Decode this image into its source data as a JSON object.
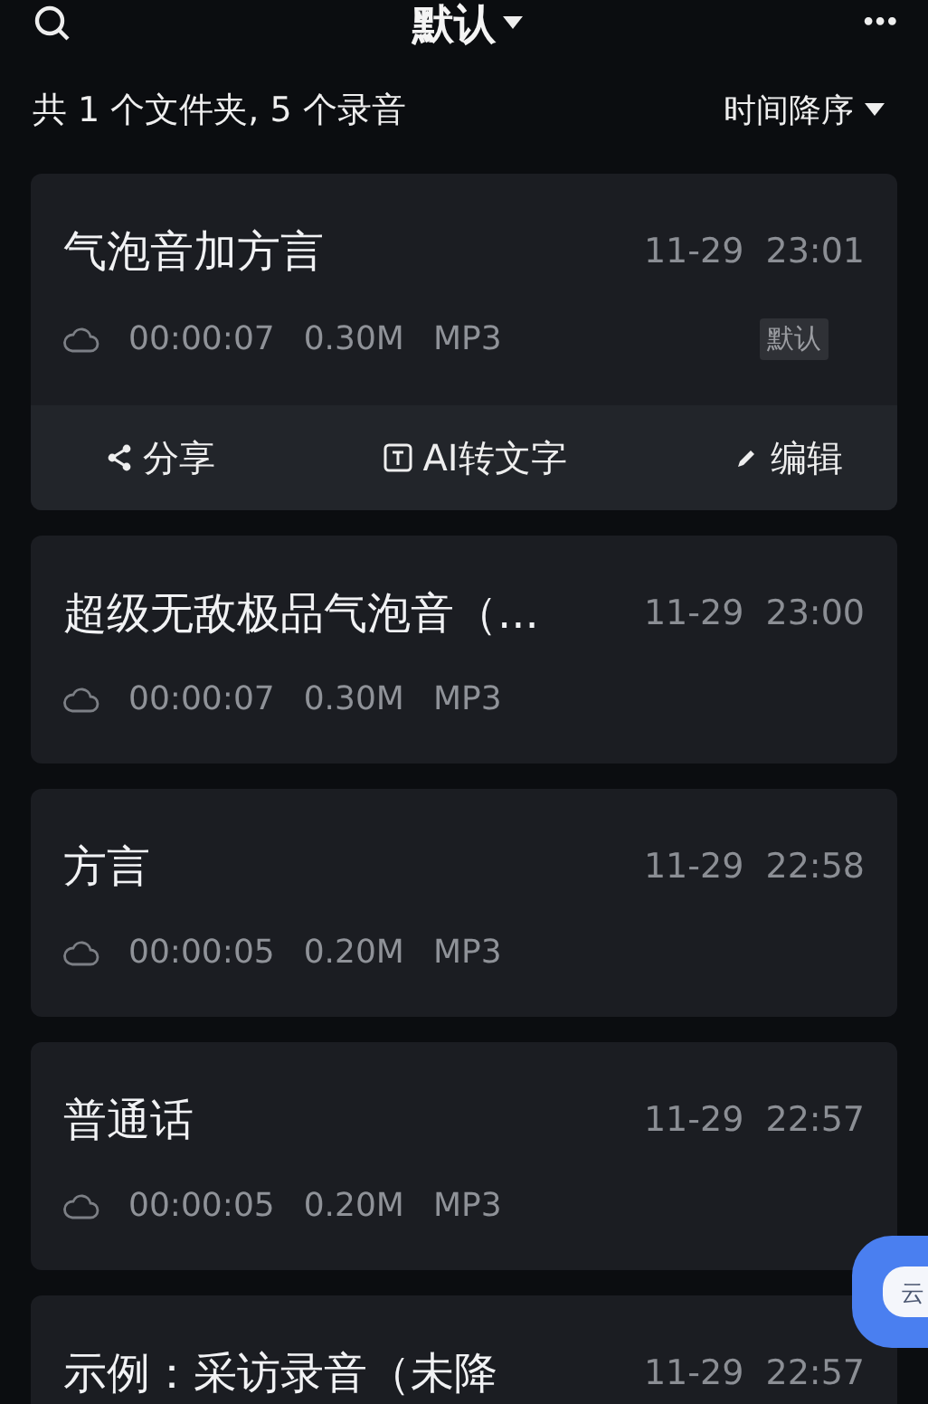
{
  "header": {
    "title": "默认",
    "more": "•••"
  },
  "summary": {
    "text": "共 1 个文件夹, 5 个录音",
    "sort": "时间降序"
  },
  "recordings": [
    {
      "title": "气泡音加方言",
      "date": "11-29",
      "time": "23:01",
      "duration": "00:00:07",
      "size": "0.30M",
      "format": "MP3",
      "tag": "默认",
      "actions": [
        {
          "kind": "share",
          "label": "分享"
        },
        {
          "kind": "transcribe",
          "label": "AI转文字"
        },
        {
          "kind": "edit",
          "label": "编辑"
        }
      ]
    },
    {
      "title": "超级无敌极品气泡音（...",
      "date": "11-29",
      "time": "23:00",
      "duration": "00:00:07",
      "size": "0.30M",
      "format": "MP3"
    },
    {
      "title": "方言",
      "date": "11-29",
      "time": "22:58",
      "duration": "00:00:05",
      "size": "0.20M",
      "format": "MP3"
    },
    {
      "title": "普通话",
      "date": "11-29",
      "time": "22:57",
      "duration": "00:00:05",
      "size": "0.20M",
      "format": "MP3"
    },
    {
      "title": "示例：采访录音（未降",
      "date": "11-29",
      "time": "22:57"
    }
  ],
  "cloud_button": {
    "label": "云"
  }
}
